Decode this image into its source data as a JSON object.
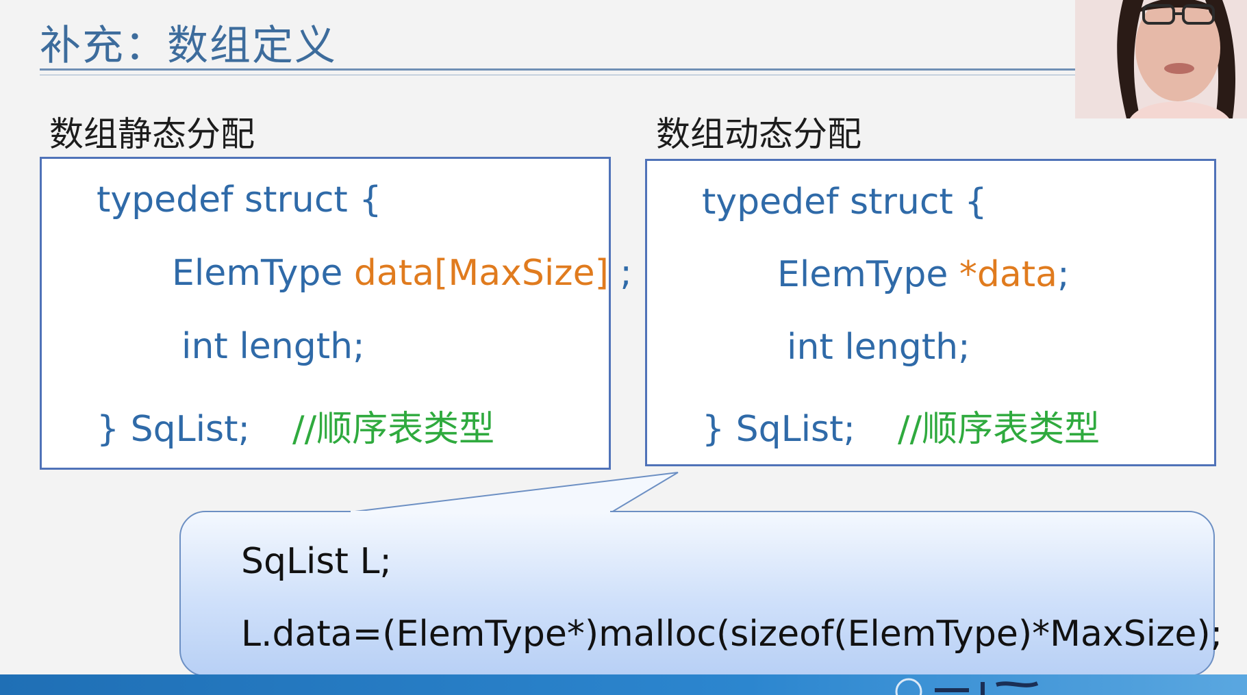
{
  "slide": {
    "title": "补充：数组定义"
  },
  "left_panel": {
    "heading": "数组静态分配",
    "line1": "typedef struct {",
    "line2_type": "ElemType ",
    "line2_field": "data[MaxSize]",
    "line2_end": " ;",
    "line3": "int length;",
    "line4_code": "} SqList;",
    "line4_comment": "//顺序表类型"
  },
  "right_panel": {
    "heading": "数组动态分配",
    "line1": "typedef struct {",
    "line2_type": "ElemType ",
    "line2_field": "*data",
    "line2_end": ";",
    "line3": "int length;",
    "line4_code": "} SqList;",
    "line4_comment": "//顺序表类型"
  },
  "callout": {
    "line1": "SqList L;",
    "line2": "L.data=(ElemType*)malloc(sizeof(ElemType)*MaxSize);"
  },
  "colors": {
    "code_blue": "#2f6aa8",
    "highlight_orange": "#e07b1e",
    "comment_green": "#2faa3e",
    "title_blue": "#3d6c9c"
  },
  "icons": {
    "webcam": "presenter-webcam-feed",
    "logo": "university-logo"
  }
}
